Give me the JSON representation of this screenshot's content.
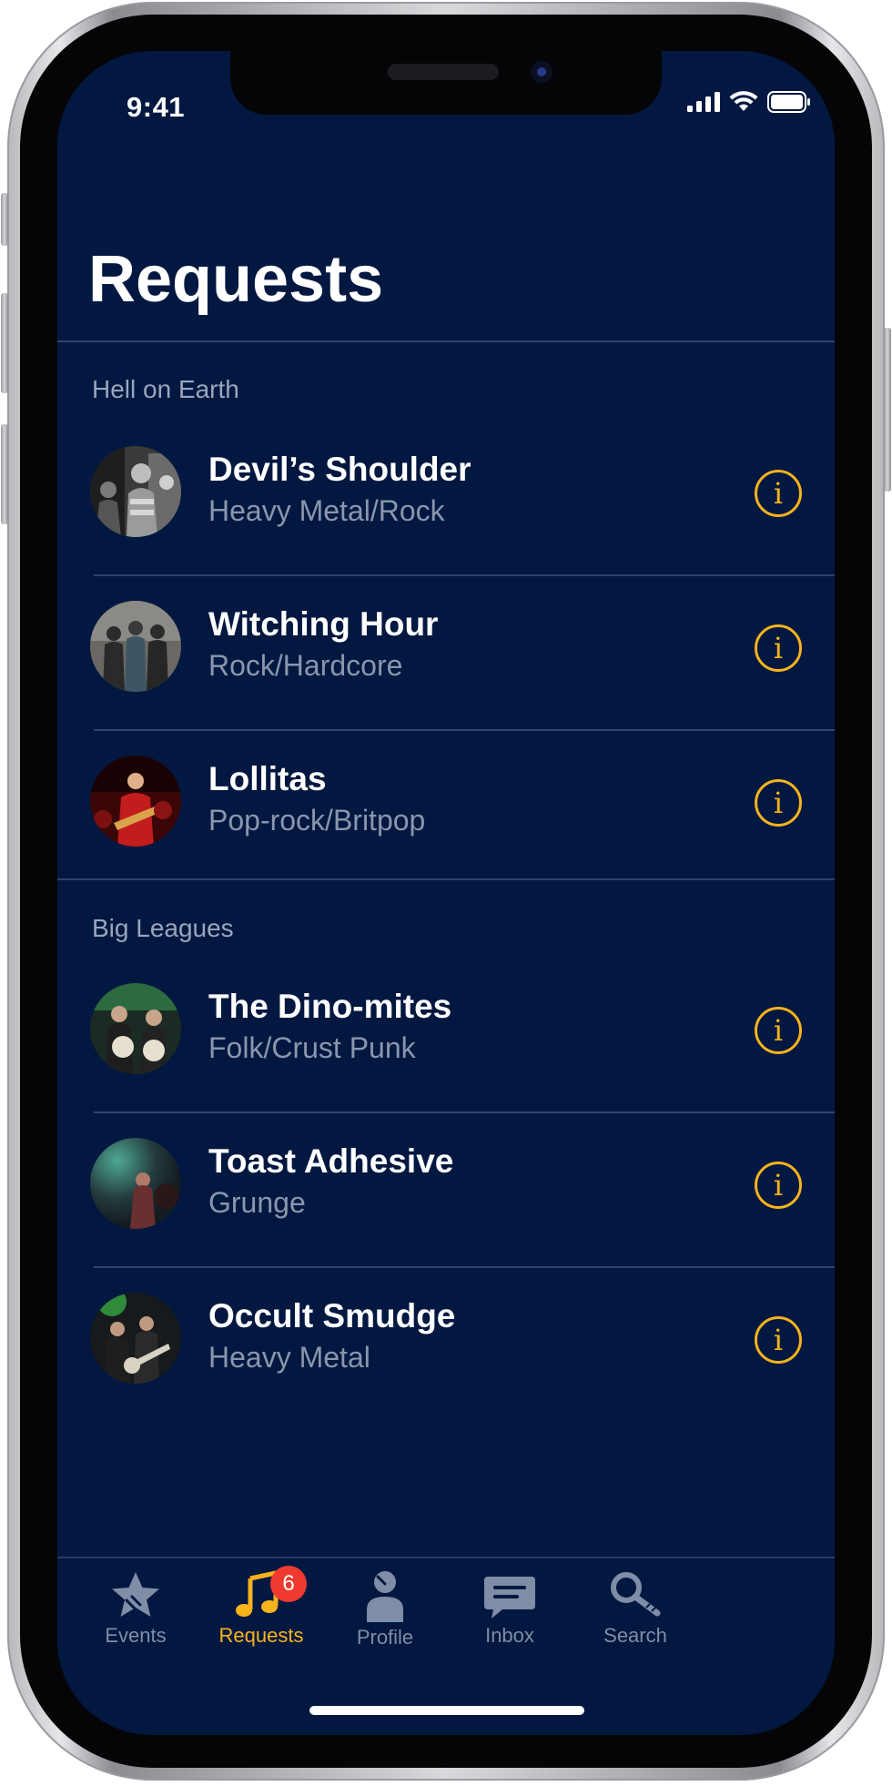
{
  "status_bar": {
    "time": "9:41"
  },
  "header": {
    "title": "Requests"
  },
  "sections": [
    {
      "title": "Hell on Earth",
      "items": [
        {
          "name": "Devil’s Shoulder",
          "genre": "Heavy Metal/Rock"
        },
        {
          "name": "Witching Hour",
          "genre": "Rock/Hardcore"
        },
        {
          "name": "Lollitas",
          "genre": "Pop-rock/Britpop"
        }
      ]
    },
    {
      "title": "Big Leagues",
      "items": [
        {
          "name": "The Dino-mites",
          "genre": "Folk/Crust Punk"
        },
        {
          "name": "Toast Adhesive",
          "genre": "Grunge"
        },
        {
          "name": "Occult Smudge",
          "genre": "Heavy Metal"
        }
      ]
    }
  ],
  "info_glyph": "i",
  "tab_bar": {
    "tabs": [
      {
        "label": "Events",
        "icon": "star-icon"
      },
      {
        "label": "Requests",
        "icon": "music-note-icon",
        "badge": "6",
        "active": true
      },
      {
        "label": "Profile",
        "icon": "person-icon"
      },
      {
        "label": "Inbox",
        "icon": "message-icon"
      },
      {
        "label": "Search",
        "icon": "magnifier-icon"
      }
    ]
  },
  "colors": {
    "background": "#021840",
    "accent": "#f7b31c",
    "badge": "#f03a30",
    "secondary_text": "#8996ad",
    "inactive_tab": "#7f8da6"
  }
}
